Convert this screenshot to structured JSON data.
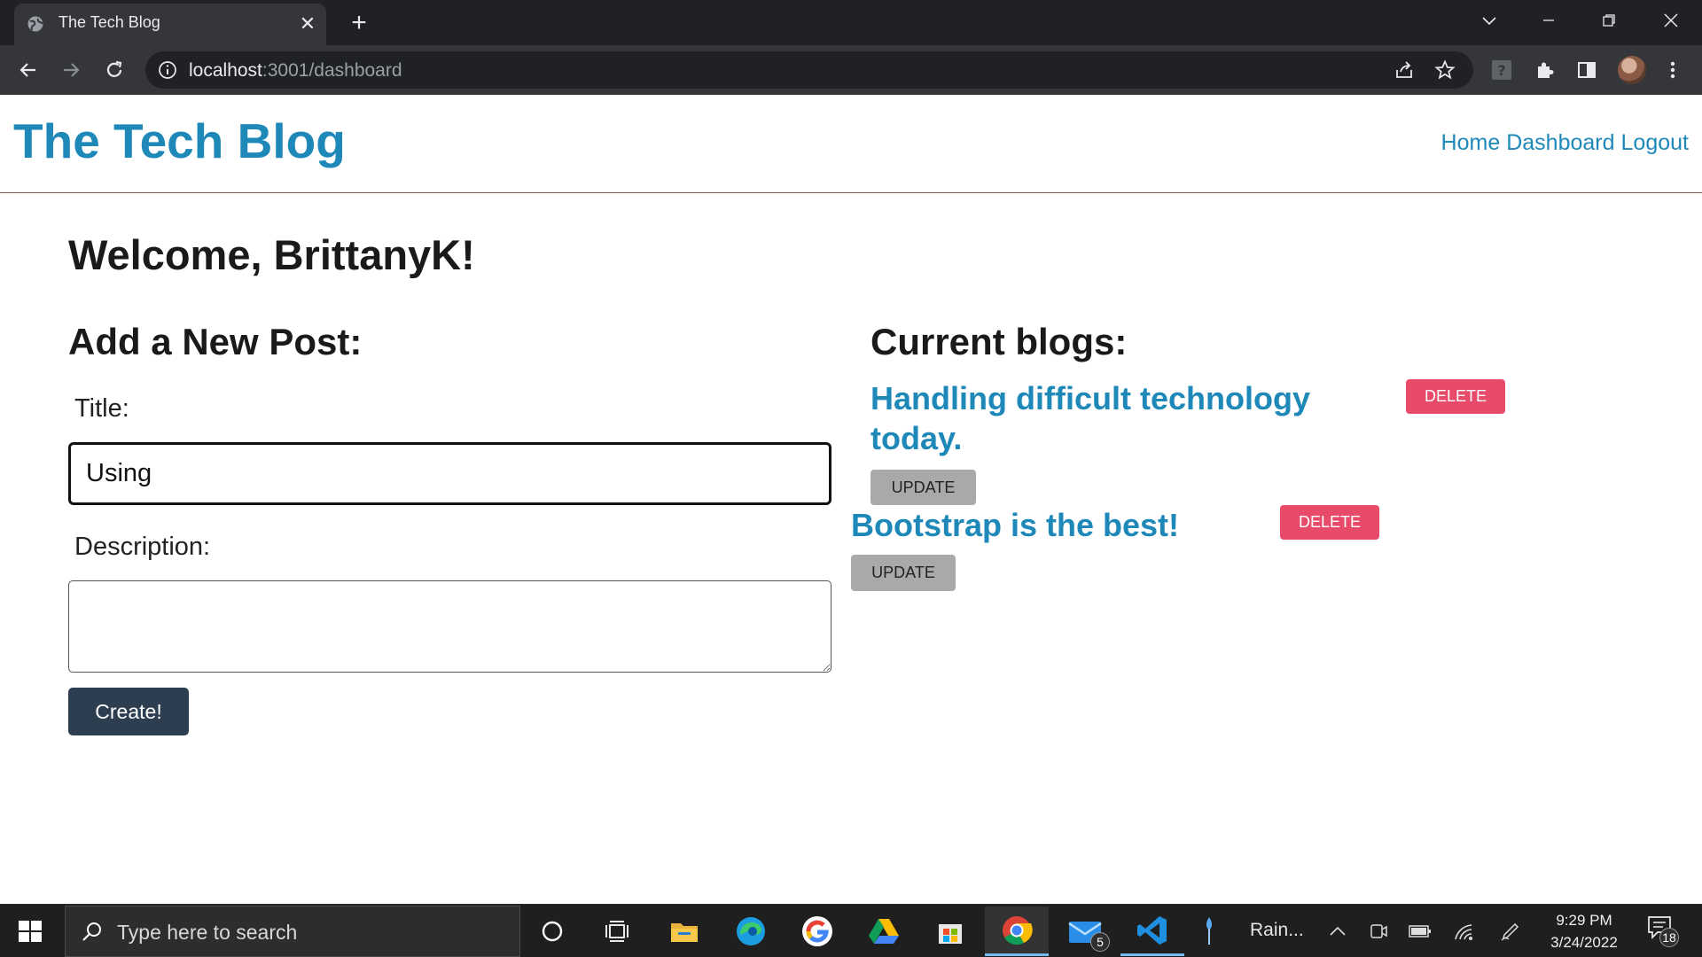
{
  "browser": {
    "tab_title": "The Tech Blog",
    "url_host": "localhost",
    "url_path": ":3001/dashboard"
  },
  "site": {
    "title": "The Tech Blog",
    "nav": [
      "Home",
      "Dashboard",
      "Logout"
    ]
  },
  "dashboard": {
    "welcome": "Welcome, BrittanyK!",
    "add_heading": "Add a New Post:",
    "title_label": "Title:",
    "title_value": "Using",
    "description_label": "Description:",
    "description_value": "",
    "create_label": "Create!",
    "current_heading": "Current blogs:",
    "blogs": [
      {
        "title": "Handling difficult technology today.",
        "delete_label": "DELETE",
        "update_label": "UPDATE"
      },
      {
        "title": "Bootstrap is the best!",
        "delete_label": "DELETE",
        "update_label": "UPDATE"
      }
    ]
  },
  "taskbar": {
    "search_placeholder": "Type here to search",
    "weather_label": "Rain...",
    "mail_badge": "5",
    "time": "9:29 PM",
    "date": "3/24/2022",
    "notification_count": "18"
  },
  "colors": {
    "brand_blue": "#1e88b8",
    "create_button": "#2c3e50",
    "delete_button": "#e84a6a",
    "update_button": "#a9a9a9"
  }
}
